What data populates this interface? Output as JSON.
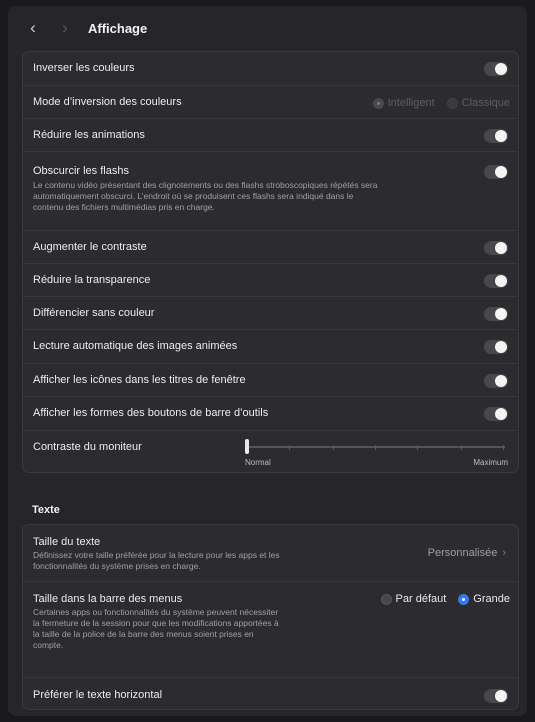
{
  "window": {
    "title": "Affichage",
    "back_icon": "chevron-left-icon",
    "forward_icon": "chevron-right-icon"
  },
  "display": {
    "invert_colors": {
      "label": "Inverser les couleurs",
      "enabled": false
    },
    "invert_mode": {
      "label": "Mode d’inversion des couleurs",
      "options": [
        "Intelligent",
        "Classique"
      ],
      "selected": "Intelligent",
      "disabled": true
    },
    "reduce_motion": {
      "label": "Réduire les animations",
      "enabled": false
    },
    "dim_flashes": {
      "label": "Obscurcir les flashs",
      "description_lines": [
        "Le contenu vidéo présentant des clignotements ou des flashs stroboscopiques répétés sera",
        "automatiquement obscurci. L’endroit où se produisent ces flashs sera indiqué dans le",
        "contenu des fichiers multimédias pris en charge."
      ],
      "enabled": false
    },
    "increase_contrast": {
      "label": "Augmenter le contraste",
      "enabled": false
    },
    "reduce_transparency": {
      "label": "Réduire la transparence",
      "enabled": false
    },
    "differentiate_without_color": {
      "label": "Différencier sans couleur",
      "enabled": false
    },
    "autoplay_animated_images": {
      "label": "Lecture automatique des images animées",
      "enabled": false
    },
    "show_window_title_icons": {
      "label": "Afficher les icônes dans les titres de fenêtre",
      "enabled": false
    },
    "show_toolbar_button_shapes": {
      "label": "Afficher les formes des boutons de barre d’outils",
      "enabled": false
    },
    "display_contrast": {
      "label": "Contraste du moniteur",
      "min_label": "Normal",
      "max_label": "Maximum",
      "value": 0
    }
  },
  "text_section": {
    "header": "Texte",
    "text_size": {
      "label": "Taille du texte",
      "description_lines": [
        "Définissez votre taille préférée pour la lecture pour les apps et les",
        "fonctionnalités du système prises en charge."
      ],
      "value": "Personnalisée"
    },
    "menu_bar_size": {
      "label": "Taille dans la barre des menus",
      "description_lines": [
        "Certaines apps ou fonctionnalités du système peuvent nécessiter",
        "la fermeture de la session pour que les modifications apportées à",
        "la taille de la police de la barre des menus soient prises en",
        "compte."
      ],
      "options": [
        "Par défaut",
        "Grande"
      ],
      "selected": "Grande"
    },
    "prefer_horizontal_text": {
      "label": "Préférer le texte horizontal",
      "enabled": false
    }
  },
  "colors": {
    "accent": "#2f7bf5",
    "window_bg": "#262628",
    "group_bg": "#2c2c2e"
  }
}
